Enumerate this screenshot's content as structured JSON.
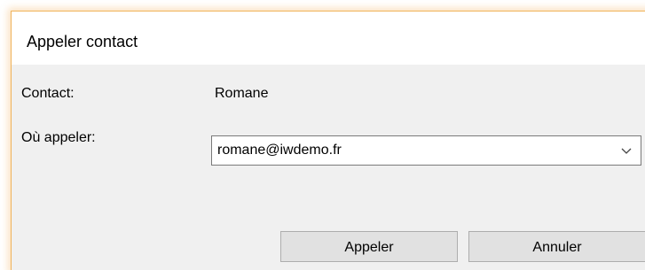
{
  "window": {
    "title": "Appeler contact"
  },
  "form": {
    "contact_label": "Contact:",
    "contact_value": "Romane",
    "where_label": "Où appeler:",
    "where_value": "romane@iwdemo.fr"
  },
  "buttons": {
    "call_label": "Appeler",
    "cancel_label": "Annuler"
  },
  "icons": {
    "dropdown": "chevron-down-icon"
  },
  "colors": {
    "window_border": "#f0b35a",
    "dialog_background": "#f0f0f0",
    "button_background": "#e1e1e1"
  }
}
